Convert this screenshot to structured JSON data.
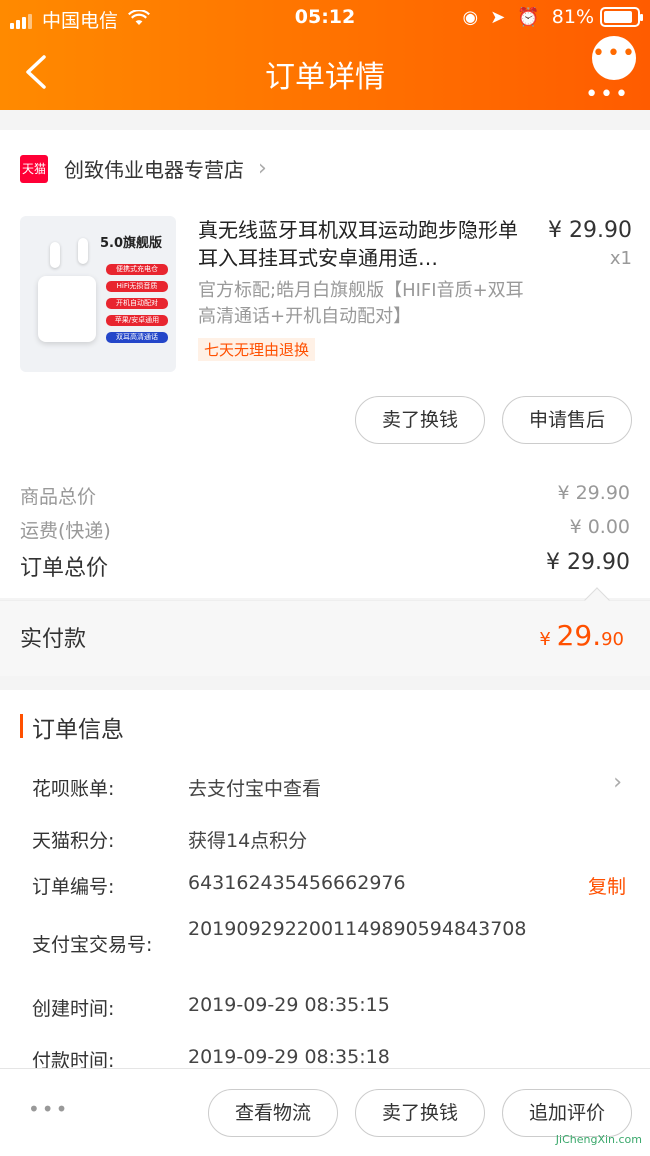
{
  "status": {
    "carrier": "中国电信",
    "time": "05:12",
    "battery": "81%"
  },
  "nav": {
    "title": "订单详情",
    "more": "•••"
  },
  "shop": {
    "badge": "天猫",
    "name": "创致伟业电器专营店"
  },
  "product": {
    "title": "真无线蓝牙耳机双耳运动跑步隐形单耳入耳挂耳式安卓通用适…",
    "spec": "官方标配;皓月白旗舰版【HIFI音质+双耳高清通话+开机自动配对】",
    "badge": "七天无理由退换",
    "price": "¥ 29.90",
    "qty": "x1",
    "image": {
      "badge": "5.0旗舰版",
      "tags": [
        "便携式充电仓",
        "HiFi无损音质",
        "开机自动配对",
        "苹果/安卓通用",
        "双耳高清通话"
      ]
    }
  },
  "actions": {
    "sell": "卖了换钱",
    "aftersale": "申请售后"
  },
  "summary": {
    "goods_label": "商品总价",
    "goods_value": "¥ 29.90",
    "ship_label": "运费(快递)",
    "ship_value": "¥ 0.00",
    "total_label": "订单总价",
    "total_value": "¥ 29.90"
  },
  "paid": {
    "label": "实付款",
    "currency": "¥ ",
    "main": "29.",
    "cents": "90"
  },
  "order_info": {
    "title": "订单信息",
    "rows": [
      {
        "label": "花呗账单:",
        "value": "去支付宝中查看"
      },
      {
        "label": "天猫积分:",
        "value": "获得14点积分"
      },
      {
        "label": "订单编号:",
        "value": "643162435456662976",
        "action": "复制"
      },
      {
        "label": "支付宝交易号:",
        "value": "2019092922001149890594843708"
      },
      {
        "label": "创建时间:",
        "value": "2019-09-29 08:35:15"
      },
      {
        "label": "付款时间:",
        "value": "2019-09-29 08:35:18"
      }
    ]
  },
  "bottom": {
    "more": "•••",
    "logistics": "查看物流",
    "sell": "卖了换钱",
    "review": "追加评价"
  },
  "watermark": "JiChengXin.com"
}
